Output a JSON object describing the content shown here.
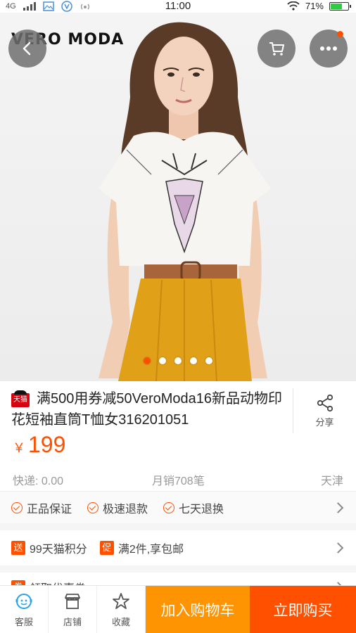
{
  "status_bar": {
    "network": "4G",
    "time": "11:00",
    "battery": "71%",
    "battery_level": 0.71
  },
  "hero": {
    "brand": "VERO MODA",
    "back_icon": "chevron-left-icon",
    "cart_icon": "cart-icon",
    "more_icon": "more-dots-icon",
    "carousel": {
      "count": 5,
      "active_index": 0
    }
  },
  "product": {
    "badge": "天猫",
    "title": "满500用券减50VeroModa16新品动物印花短袖直筒T恤女316201051",
    "share_label": "分享",
    "price_symbol": "￥",
    "price": "199"
  },
  "meta": {
    "shipping": "快递: 0.00",
    "monthly_sales": "月销708笔",
    "location": "天津"
  },
  "guarantees": [
    "正品保证",
    "极速退款",
    "七天退换"
  ],
  "promotions": [
    {
      "tag": "送",
      "text": "99天猫积分"
    },
    {
      "tag": "促",
      "text": "满2件,享包邮"
    }
  ],
  "coupon": {
    "tag": "券",
    "text": "领取优惠券"
  },
  "bottom_bar": {
    "service": "客服",
    "shop": "店铺",
    "favorite": "收藏",
    "add_to_cart": "加入购物车",
    "buy_now": "立即购买"
  },
  "colors": {
    "accent": "#ff5000",
    "cart_orange": "#ff9402",
    "tmall_red": "#d6000f"
  }
}
